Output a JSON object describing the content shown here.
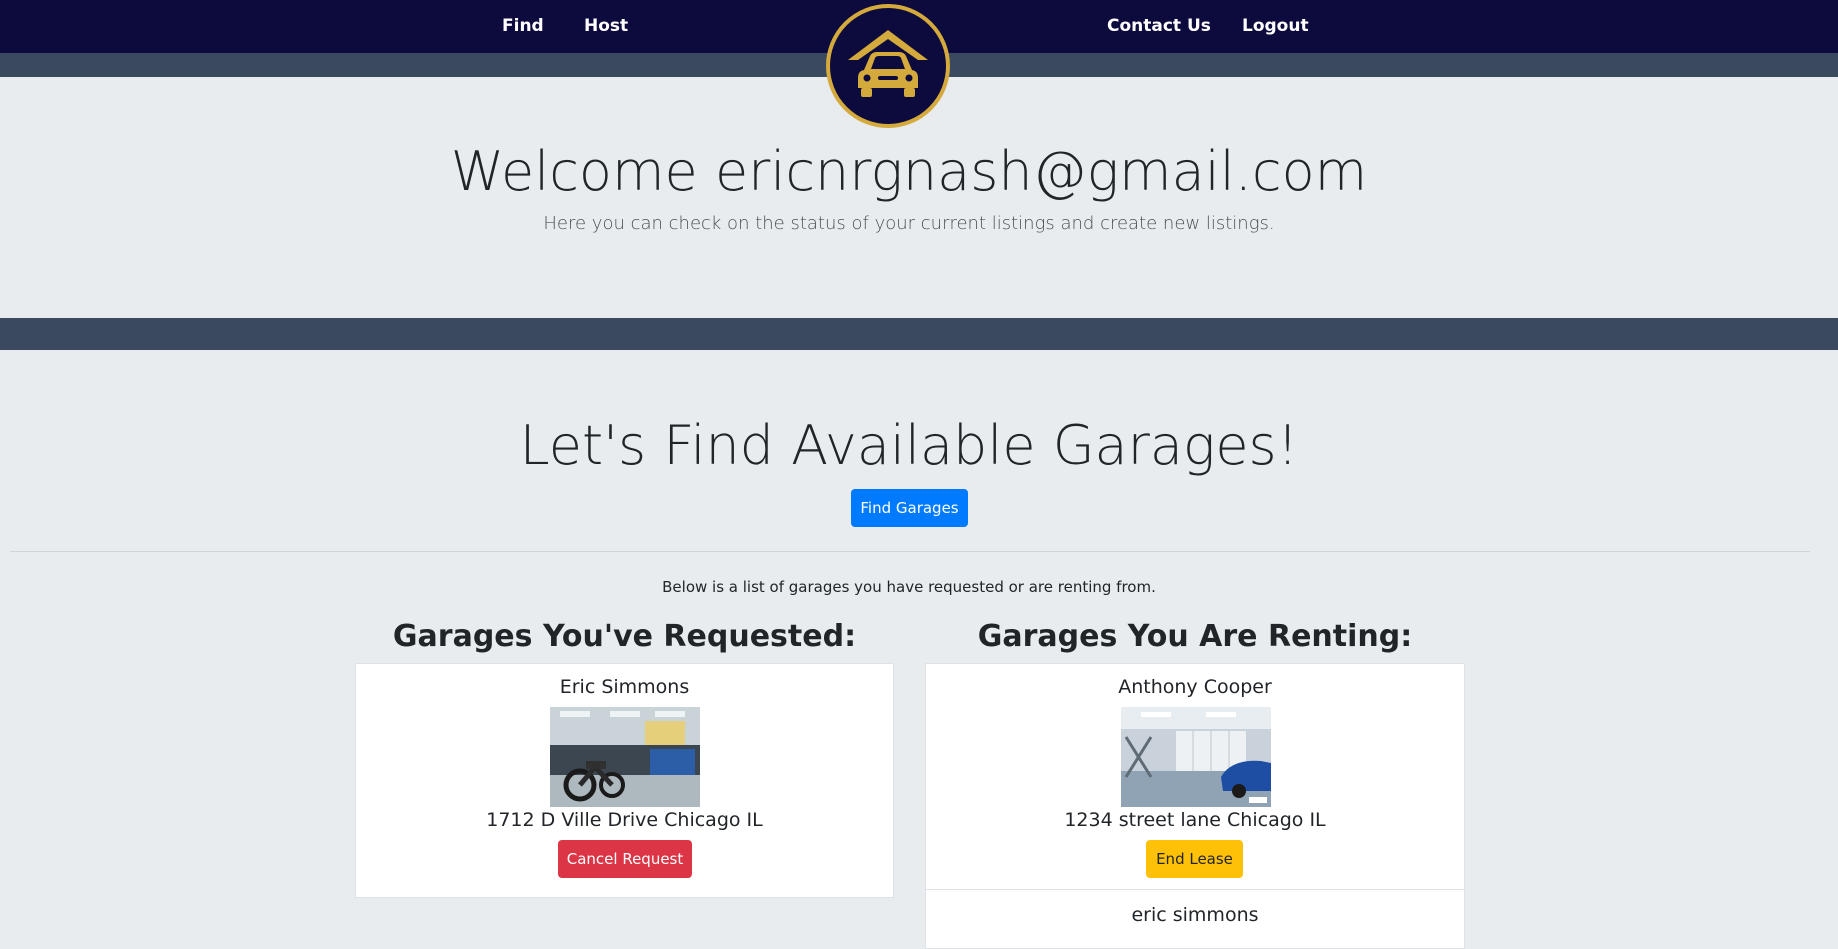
{
  "nav": {
    "find_label": "Find",
    "host_label": "Host",
    "contact_label": "Contact Us",
    "logout_label": "Logout",
    "logo_icon": "garage-car-icon"
  },
  "welcome": {
    "title": "Welcome ericnrgnash@gmail.com",
    "subtitle": "Here you can check on the status of your current listings and create new listings."
  },
  "find": {
    "title": "Let's Find Available Garages!",
    "button_label": "Find Garages"
  },
  "list_intro": "Below is a list of garages you have requested or are renting from.",
  "requested": {
    "title": "Garages You've Requested:",
    "items": [
      {
        "name": "Eric Simmons",
        "address": "1712 D Ville Drive Chicago IL",
        "button_label": "Cancel Request",
        "photo_icon": "garage-motorcycle-photo"
      }
    ]
  },
  "renting": {
    "title": "Garages You Are Renting:",
    "items": [
      {
        "name": "Anthony Cooper",
        "address": "1234 street lane Chicago IL",
        "button_label": "End Lease",
        "photo_icon": "garage-car-photo"
      },
      {
        "name": "eric simmons"
      }
    ]
  },
  "colors": {
    "navbar": "#0d0a3d",
    "band": "#3a4960",
    "logo_gold": "#d4aa3c",
    "primary": "#007bff",
    "danger": "#dc3545",
    "warning": "#ffc107",
    "page_bg": "#e9ecef"
  }
}
